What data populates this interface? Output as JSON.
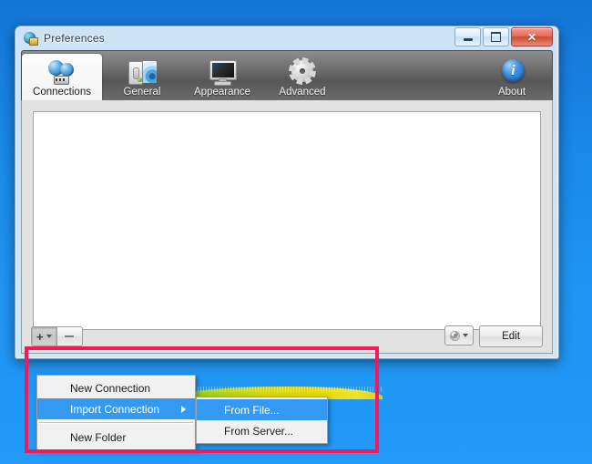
{
  "window": {
    "title": "Preferences",
    "title_icon": "globe-lock-icon",
    "controls": {
      "minimize": "minimize-button",
      "maximize": "maximize-button",
      "close_glyph": "✕"
    }
  },
  "tabs": [
    {
      "label": "Connections",
      "icon": "connections-icon",
      "active": true
    },
    {
      "label": "General",
      "icon": "general-icon",
      "active": false
    },
    {
      "label": "Appearance",
      "icon": "appearance-icon",
      "active": false
    },
    {
      "label": "Advanced",
      "icon": "advanced-gear-icon",
      "active": false
    },
    {
      "label": "About",
      "icon": "about-info-icon",
      "active": false
    }
  ],
  "content": {
    "list_items": []
  },
  "toolbar": {
    "add_label": "+",
    "add_caret": "dropdown-caret",
    "remove_label": "−",
    "gear_label": "settings-gear",
    "edit_label": "Edit"
  },
  "context_menu": {
    "items": [
      {
        "label": "New Connection",
        "selected": false,
        "submenu": false
      },
      {
        "label": "Import Connection",
        "selected": true,
        "submenu": true
      },
      {
        "separator": true
      },
      {
        "label": "New Folder",
        "selected": false,
        "submenu": false
      }
    ]
  },
  "submenu": {
    "items": [
      {
        "label": "From File...",
        "selected": true
      },
      {
        "label": "From Server...",
        "selected": false
      }
    ]
  },
  "annotation": {
    "highlight_color": "#f01b5c"
  },
  "desktop": {
    "background_color": "#1a8ae8"
  }
}
